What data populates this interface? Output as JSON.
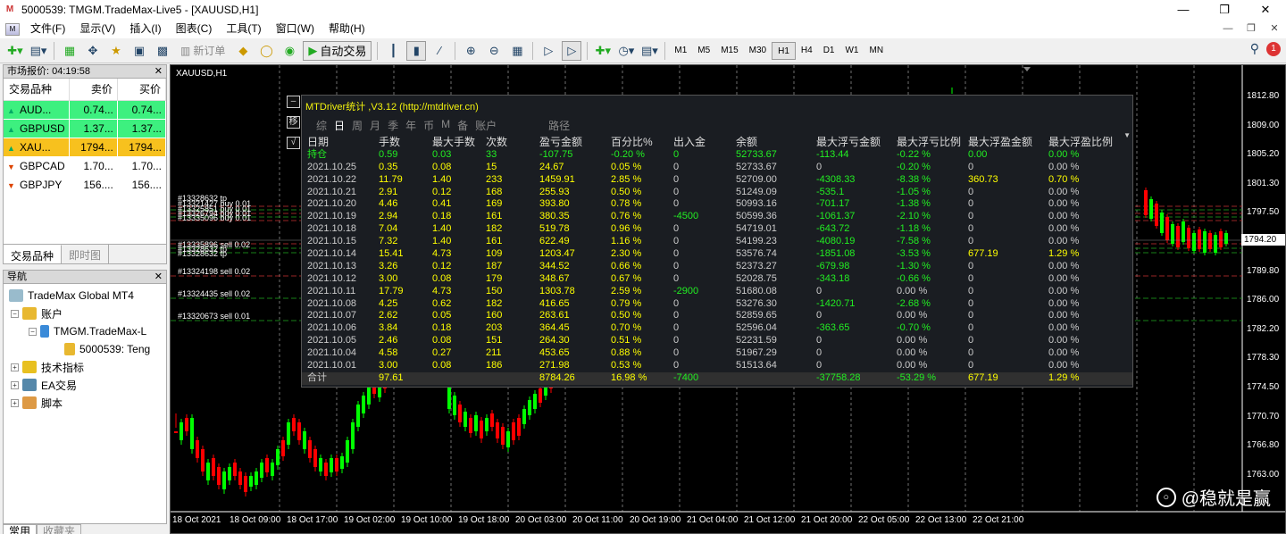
{
  "window": {
    "title": "5000539: TMGM.TradeMax-Live5 - [XAUUSD,H1]",
    "icon": "mt4-icon"
  },
  "menu": [
    "文件(F)",
    "显示(V)",
    "插入(I)",
    "图表(C)",
    "工具(T)",
    "窗口(W)",
    "帮助(H)"
  ],
  "toolbar": {
    "new_order": "新订单",
    "autotrade": "自动交易",
    "timeframes": [
      "M1",
      "M5",
      "M15",
      "M30",
      "H1",
      "H4",
      "D1",
      "W1",
      "MN"
    ],
    "active_tf": "H1",
    "notification_count": "1"
  },
  "market_watch": {
    "title": "市场报价: 04:19:58",
    "headers": [
      "交易品种",
      "卖价",
      "买价"
    ],
    "rows": [
      {
        "symbol": "AUD...",
        "bid": "0.74...",
        "ask": "0.74...",
        "dir": "up",
        "bg": "#3df07f"
      },
      {
        "symbol": "GBPUSD",
        "bid": "1.37...",
        "ask": "1.37...",
        "dir": "up",
        "bg": "#3df07f"
      },
      {
        "symbol": "XAU...",
        "bid": "1794...",
        "ask": "1794...",
        "dir": "up",
        "bg": "#f7c11e"
      },
      {
        "symbol": "GBPCAD",
        "bid": "1.70...",
        "ask": "1.70...",
        "dir": "down",
        "bg": "#ffffff"
      },
      {
        "symbol": "GBPJPY",
        "bid": "156....",
        "ask": "156....",
        "dir": "down",
        "bg": "#ffffff"
      }
    ],
    "tabs": [
      "交易品种",
      "即时图"
    ]
  },
  "navigator": {
    "title": "导航",
    "items": [
      "TradeMax Global MT4",
      "账户",
      "TMGM.TradeMax-L",
      "5000539: Teng",
      "技术指标",
      "EA交易",
      "脚本"
    ],
    "tabs": [
      "常用",
      "收藏夹"
    ]
  },
  "chart": {
    "symbol_label": "XAUUSD,H1",
    "price_labels": [
      "1812.80",
      "1809.00",
      "1805.20",
      "1801.30",
      "1797.50",
      "1793.70",
      "1789.80",
      "1786.00",
      "1782.20",
      "1778.30",
      "1774.50",
      "1770.70",
      "1766.80",
      "1763.00"
    ],
    "current_price": "1794.20",
    "time_labels": [
      "18 Oct 2021",
      "18 Oct 09:00",
      "18 Oct 17:00",
      "19 Oct 02:00",
      "19 Oct 10:00",
      "19 Oct 18:00",
      "20 Oct 03:00",
      "20 Oct 11:00",
      "20 Oct 19:00",
      "21 Oct 04:00",
      "21 Oct 12:00",
      "21 Oct 20:00",
      "22 Oct 05:00",
      "22 Oct 13:00",
      "22 Oct 21:00"
    ],
    "order_tags": [
      "#13328632 tp",
      "#13321427 buy 0.01",
      "#13325851 buy 0.01",
      "#13326794 buy 0.01",
      "#13335096 buy 0.01",
      "#13335896 sell 0.02",
      "#13328632 tp",
      "#13328632 tp",
      "#13324198 sell 0.02",
      "#13324435 sell 0.02",
      "#13320673 sell 0.01"
    ],
    "watermark": "@稳就是赢"
  },
  "stats": {
    "header": "MTDriver统计 ,V3.12 (http://mtdriver.cn)",
    "tabs": [
      "综",
      "日",
      "周",
      "月",
      "季",
      "年",
      "币",
      "M",
      "备",
      "账户",
      "路径"
    ],
    "selected_tab": "日",
    "side_buttons": [
      "–",
      "移",
      "√"
    ],
    "columns": [
      "日期",
      "手数",
      "最大手数",
      "次数",
      "盈亏金额",
      "百分比%",
      "出入金",
      "余额",
      "最大浮亏金额",
      "最大浮亏比例",
      "最大浮盈金额",
      "最大浮盈比例"
    ],
    "position_row": [
      "持仓",
      "0.59",
      "0.03",
      "33",
      "-107.75",
      "-0.20 %",
      "0",
      "52733.67",
      "-113.44",
      "-0.22 %",
      "0.00",
      "0.00 %"
    ],
    "rows": [
      [
        "2021.10.25",
        "0.35",
        "0.08",
        "15",
        "24.67",
        "0.05 %",
        "0",
        "52733.67",
        "0",
        "-0.20 %",
        "0",
        "0.00 %"
      ],
      [
        "2021.10.22",
        "11.79",
        "1.40",
        "233",
        "1459.91",
        "2.85 %",
        "0",
        "52709.00",
        "-4308.33",
        "-8.38 %",
        "360.73",
        "0.70 %"
      ],
      [
        "2021.10.21",
        "2.91",
        "0.12",
        "168",
        "255.93",
        "0.50 %",
        "0",
        "51249.09",
        "-535.1",
        "-1.05 %",
        "0",
        "0.00 %"
      ],
      [
        "2021.10.20",
        "4.46",
        "0.41",
        "169",
        "393.80",
        "0.78 %",
        "0",
        "50993.16",
        "-701.17",
        "-1.38 %",
        "0",
        "0.00 %"
      ],
      [
        "2021.10.19",
        "2.94",
        "0.18",
        "161",
        "380.35",
        "0.76 %",
        "-4500",
        "50599.36",
        "-1061.37",
        "-2.10 %",
        "0",
        "0.00 %"
      ],
      [
        "2021.10.18",
        "7.04",
        "1.40",
        "182",
        "519.78",
        "0.96 %",
        "0",
        "54719.01",
        "-643.72",
        "-1.18 %",
        "0",
        "0.00 %"
      ],
      [
        "2021.10.15",
        "7.32",
        "1.40",
        "161",
        "622.49",
        "1.16 %",
        "0",
        "54199.23",
        "-4080.19",
        "-7.58 %",
        "0",
        "0.00 %"
      ],
      [
        "2021.10.14",
        "15.41",
        "4.73",
        "109",
        "1203.47",
        "2.30 %",
        "0",
        "53576.74",
        "-1851.08",
        "-3.53 %",
        "677.19",
        "1.29 %"
      ],
      [
        "2021.10.13",
        "3.26",
        "0.12",
        "187",
        "344.52",
        "0.66 %",
        "0",
        "52373.27",
        "-679.98",
        "-1.30 %",
        "0",
        "0.00 %"
      ],
      [
        "2021.10.12",
        "3.00",
        "0.08",
        "179",
        "348.67",
        "0.67 %",
        "0",
        "52028.75",
        "-343.18",
        "-0.66 %",
        "0",
        "0.00 %"
      ],
      [
        "2021.10.11",
        "17.79",
        "4.73",
        "150",
        "1303.78",
        "2.59 %",
        "-2900",
        "51680.08",
        "0",
        "0.00 %",
        "0",
        "0.00 %"
      ],
      [
        "2021.10.08",
        "4.25",
        "0.62",
        "182",
        "416.65",
        "0.79 %",
        "0",
        "53276.30",
        "-1420.71",
        "-2.68 %",
        "0",
        "0.00 %"
      ],
      [
        "2021.10.07",
        "2.62",
        "0.05",
        "160",
        "263.61",
        "0.50 %",
        "0",
        "52859.65",
        "0",
        "0.00 %",
        "0",
        "0.00 %"
      ],
      [
        "2021.10.06",
        "3.84",
        "0.18",
        "203",
        "364.45",
        "0.70 %",
        "0",
        "52596.04",
        "-363.65",
        "-0.70 %",
        "0",
        "0.00 %"
      ],
      [
        "2021.10.05",
        "2.46",
        "0.08",
        "151",
        "264.30",
        "0.51 %",
        "0",
        "52231.59",
        "0",
        "0.00 %",
        "0",
        "0.00 %"
      ],
      [
        "2021.10.04",
        "4.58",
        "0.27",
        "211",
        "453.65",
        "0.88 %",
        "0",
        "51967.29",
        "0",
        "0.00 %",
        "0",
        "0.00 %"
      ],
      [
        "2021.10.01",
        "3.00",
        "0.08",
        "186",
        "271.98",
        "0.53 %",
        "0",
        "51513.64",
        "0",
        "0.00 %",
        "0",
        "0.00 %"
      ]
    ],
    "total_row": [
      "合计",
      "97.61",
      "",
      "",
      "8784.26",
      "16.98 %",
      "-7400",
      "",
      "-37758.28",
      "-53.29 %",
      "677.19",
      "1.29 %"
    ]
  },
  "colors": {
    "bull": "#00ff00",
    "bear": "#ff0000",
    "stat_yellow": "#ffff00",
    "stat_green": "#22ee22"
  }
}
